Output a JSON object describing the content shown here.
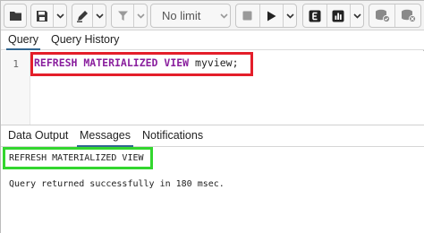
{
  "toolbar": {
    "limit_label": "No limit",
    "icons": [
      "folder-icon",
      "save-icon",
      "chevron-down-icon",
      "pen-icon",
      "chevron-down-icon",
      "filter-icon",
      "chevron-down-icon",
      "stop-icon",
      "play-icon",
      "chevron-down-icon",
      "explain-icon",
      "chart-icon",
      "chevron-down-icon",
      "commit-icon",
      "rollback-icon"
    ]
  },
  "query_tabs": [
    "Query",
    "Query History"
  ],
  "editor": {
    "line_number": "1",
    "keyword": "REFRESH MATERIALIZED VIEW",
    "identifier": "myview;"
  },
  "output_tabs": [
    "Data Output",
    "Messages",
    "Notifications"
  ],
  "messages": {
    "command": "REFRESH MATERIALIZED VIEW",
    "result": "Query returned successfully in 180 msec."
  },
  "colors": {
    "highlight_red": "#e41e2a",
    "highlight_green": "#33d62f",
    "keyword": "#8a1f9e",
    "accent": "#326690"
  }
}
